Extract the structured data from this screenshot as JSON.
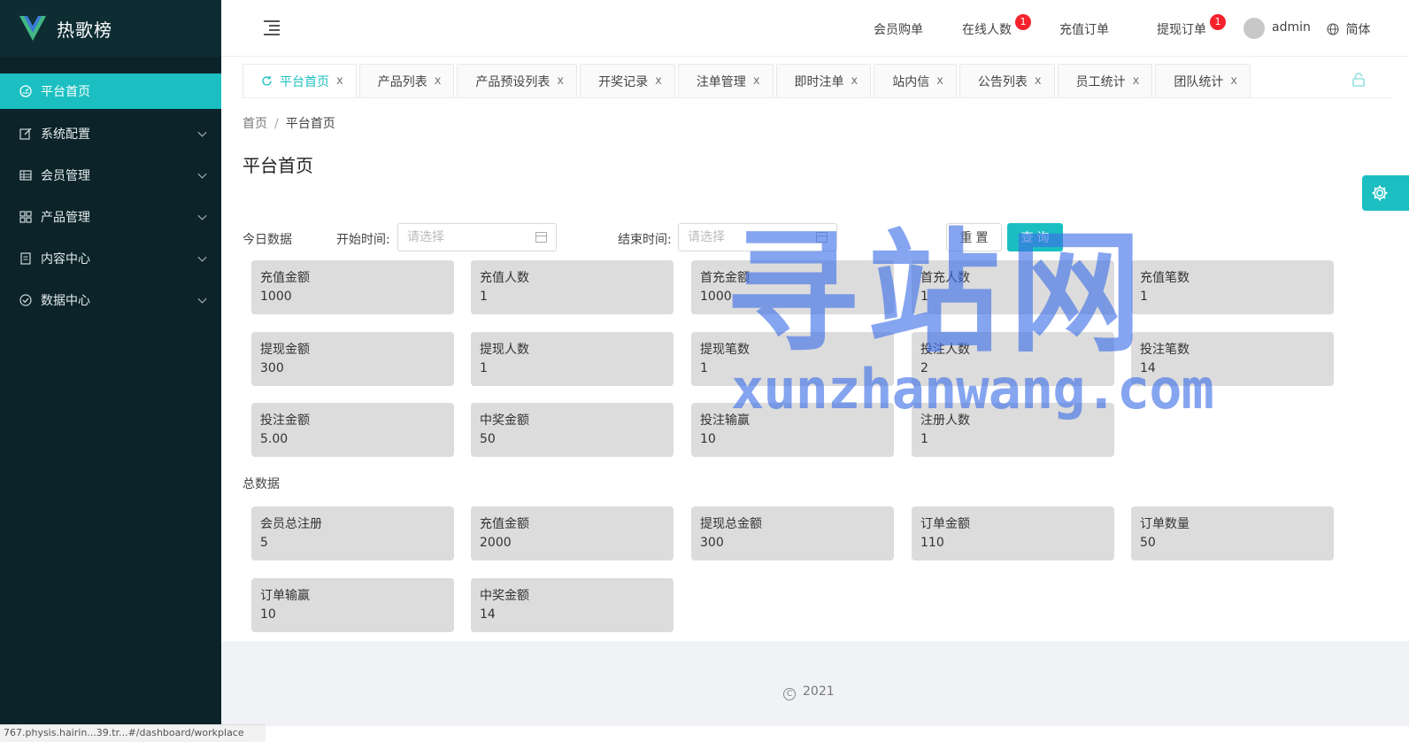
{
  "app": {
    "title": "热歌榜"
  },
  "sidebar": {
    "items": [
      {
        "label": "平台首页",
        "icon": "dashboard-icon",
        "active": true
      },
      {
        "label": "系统配置",
        "icon": "edit-icon"
      },
      {
        "label": "会员管理",
        "icon": "table-icon"
      },
      {
        "label": "产品管理",
        "icon": "grid-icon"
      },
      {
        "label": "内容中心",
        "icon": "document-icon"
      },
      {
        "label": "数据中心",
        "icon": "check-circle-icon"
      }
    ]
  },
  "header": {
    "nav": [
      {
        "label": "会员购单"
      },
      {
        "label": "在线人数",
        "badge": "1"
      },
      {
        "label": "充值订单"
      },
      {
        "label": "提现订单",
        "badge": "1"
      }
    ],
    "user": "admin",
    "language": "简体"
  },
  "tabs": [
    {
      "label": "平台首页",
      "active": true
    },
    {
      "label": "产品列表"
    },
    {
      "label": "产品预设列表"
    },
    {
      "label": "开奖记录"
    },
    {
      "label": "注单管理"
    },
    {
      "label": "即时注单"
    },
    {
      "label": "站内信"
    },
    {
      "label": "公告列表"
    },
    {
      "label": "员工统计"
    },
    {
      "label": "团队统计"
    }
  ],
  "tab_close": "x",
  "breadcrumb": {
    "home": "首页",
    "separator": "/",
    "current": "平台首页"
  },
  "page_title": "平台首页",
  "filter": {
    "section_label": "今日数据",
    "start_label": "开始时间:",
    "end_label": "结束时间:",
    "placeholder": "请选择",
    "reset_label": "重置",
    "query_label": "查询"
  },
  "today_stats": [
    {
      "label": "充值金额",
      "value": "1000"
    },
    {
      "label": "充值人数",
      "value": "1"
    },
    {
      "label": "首充金额",
      "value": "1000"
    },
    {
      "label": "首充人数",
      "value": "1"
    },
    {
      "label": "充值笔数",
      "value": "1"
    },
    {
      "label": "提现金额",
      "value": "300"
    },
    {
      "label": "提现人数",
      "value": "1"
    },
    {
      "label": "提现笔数",
      "value": "1"
    },
    {
      "label": "投注人数",
      "value": "2"
    },
    {
      "label": "投注笔数",
      "value": "14"
    },
    {
      "label": "投注金额",
      "value": "5.00"
    },
    {
      "label": "中奖金额",
      "value": "50"
    },
    {
      "label": "投注输赢",
      "value": "10"
    },
    {
      "label": "注册人数",
      "value": "1"
    }
  ],
  "total_section_label": "总数据",
  "total_stats": [
    {
      "label": "会员总注册",
      "value": "5"
    },
    {
      "label": "充值金额",
      "value": "2000"
    },
    {
      "label": "提现总金额",
      "value": "300"
    },
    {
      "label": "订单金额",
      "value": "110"
    },
    {
      "label": "订单数量",
      "value": "50"
    },
    {
      "label": "订单输赢",
      "value": "10"
    },
    {
      "label": "中奖金额",
      "value": "14"
    }
  ],
  "footer": {
    "copyright_symbol": "C",
    "year": "2021"
  },
  "statusbar": "767.physis.hairin...39.tr...#/dashboard/workplace",
  "watermark": {
    "cn": "寻站网",
    "en": "xunzhanwang.com"
  },
  "colors": {
    "accent": "#1bbfc1",
    "sidebar": "#0b2329",
    "badge": "#f5222d",
    "card": "#dcdcdc",
    "watermark": "#3c6ee6"
  }
}
